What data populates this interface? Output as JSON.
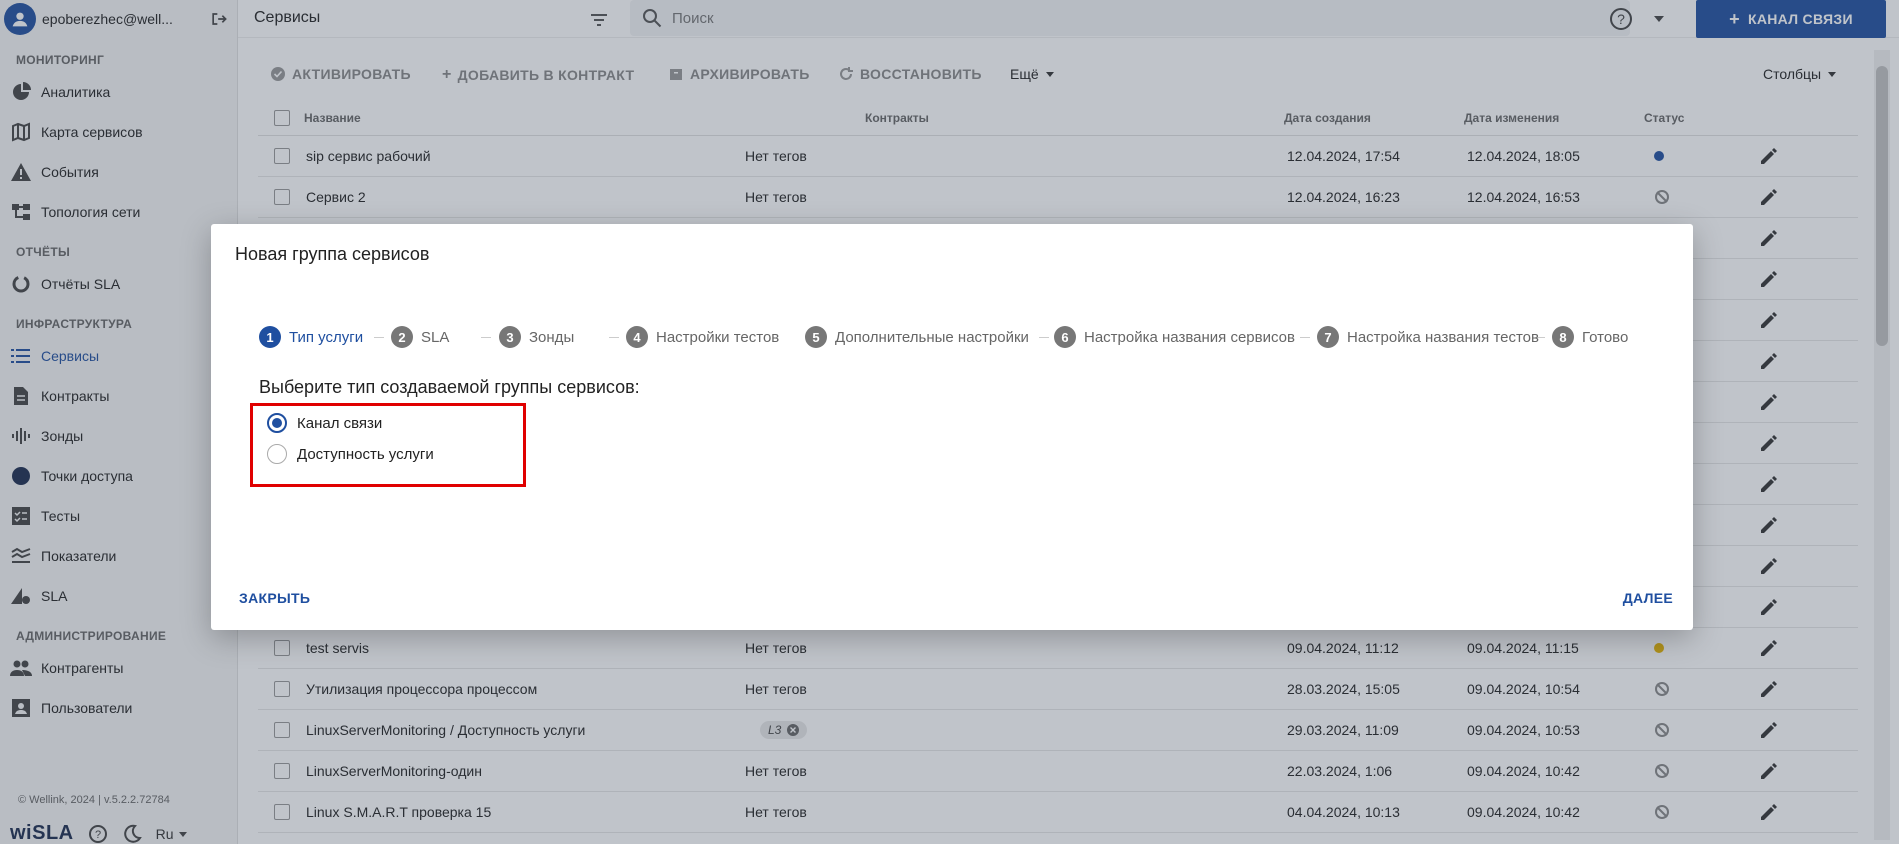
{
  "sidebar": {
    "user": "epoberezhec@well...",
    "sections": [
      {
        "title": "МОНИТОРИНГ",
        "items": [
          {
            "label": "Аналитика",
            "icon": "pie-chart-icon"
          },
          {
            "label": "Карта сервисов",
            "icon": "map-icon"
          },
          {
            "label": "События",
            "icon": "warning-icon"
          },
          {
            "label": "Топология сети",
            "icon": "topology-icon"
          }
        ]
      },
      {
        "title": "ОТЧЁТЫ",
        "items": [
          {
            "label": "Отчёты SLA",
            "icon": "donut-icon"
          }
        ]
      },
      {
        "title": "ИНФРАСТРУКТУРА",
        "items": [
          {
            "label": "Сервисы",
            "icon": "list-icon"
          },
          {
            "label": "Контракты",
            "icon": "document-icon"
          },
          {
            "label": "Зонды",
            "icon": "probe-icon"
          },
          {
            "label": "Точки доступа",
            "icon": "circle-icon"
          },
          {
            "label": "Тесты",
            "icon": "checklist-icon"
          },
          {
            "label": "Показатели",
            "icon": "metrics-icon"
          },
          {
            "label": "SLA",
            "icon": "sla-icon"
          }
        ]
      },
      {
        "title": "АДМИНИСТРИРОВАНИЕ",
        "items": [
          {
            "label": "Контрагенты",
            "icon": "people-icon"
          },
          {
            "label": "Пользователи",
            "icon": "user-card-icon"
          }
        ]
      }
    ],
    "copyright": "© Wellink, 2024 | v.5.2.2.72784",
    "logo": "wiSLA",
    "lang": "Ru"
  },
  "topbar": {
    "title": "Сервисы",
    "search_placeholder": "Поиск",
    "primary_button": "КАНАЛ СВЯЗИ"
  },
  "toolbar": {
    "activate": "АКТИВИРОВАТЬ",
    "add_contract": "ДОБАВИТЬ В КОНТРАКТ",
    "archive": "АРХИВИРОВАТЬ",
    "restore": "ВОССТАНОВИТЬ",
    "more": "Ещё",
    "columns": "Столбцы"
  },
  "table": {
    "headers": {
      "name": "Название",
      "contracts": "Контракты",
      "created": "Дата создания",
      "modified": "Дата изменения",
      "status": "Статус"
    },
    "rows": [
      {
        "name": "sip сервис рабочий",
        "tags": "Нет тегов",
        "created": "12.04.2024, 17:54",
        "modified": "12.04.2024, 18:05",
        "status": "active"
      },
      {
        "name": "Сервис 2",
        "tags": "Нет тегов",
        "created": "12.04.2024, 16:23",
        "modified": "12.04.2024, 16:53",
        "status": "disabled"
      },
      {
        "name": "",
        "tags": "",
        "created": "",
        "modified": "",
        "status": "none"
      },
      {
        "name": "",
        "tags": "",
        "created": "",
        "modified": "",
        "status": "none"
      },
      {
        "name": "",
        "tags": "",
        "created": "",
        "modified": "",
        "status": "none"
      },
      {
        "name": "",
        "tags": "",
        "created": "",
        "modified": "",
        "status": "none"
      },
      {
        "name": "",
        "tags": "",
        "created": "",
        "modified": "",
        "status": "none"
      },
      {
        "name": "",
        "tags": "",
        "created": "",
        "modified": "",
        "status": "none"
      },
      {
        "name": "",
        "tags": "",
        "created": "",
        "modified": "",
        "status": "none"
      },
      {
        "name": "",
        "tags": "",
        "created": "",
        "modified": "",
        "status": "none"
      },
      {
        "name": "",
        "tags": "",
        "created": "",
        "modified": "",
        "status": "none"
      },
      {
        "name": "",
        "tags": "",
        "created": "",
        "modified": "",
        "status": "none"
      },
      {
        "name": "test servis",
        "tags": "Нет тегов",
        "created": "09.04.2024, 11:12",
        "modified": "09.04.2024, 11:15",
        "status": "warning"
      },
      {
        "name": "Утилизация процессора процессом",
        "tags": "Нет тегов",
        "created": "28.03.2024, 15:05",
        "modified": "09.04.2024, 10:54",
        "status": "disabled"
      },
      {
        "name": "LinuxServerMonitoring / Доступность услуги",
        "tag_chip": "L3",
        "created": "29.03.2024, 11:09",
        "modified": "09.04.2024, 10:53",
        "status": "disabled"
      },
      {
        "name": "LinuxServerMonitoring-один",
        "tags": "Нет тегов",
        "created": "22.03.2024, 1:06",
        "modified": "09.04.2024, 10:42",
        "status": "disabled"
      },
      {
        "name": "Linux S.M.A.R.T проверка 15",
        "tags": "Нет тегов",
        "created": "04.04.2024, 10:13",
        "modified": "09.04.2024, 10:42",
        "status": "disabled"
      }
    ]
  },
  "modal": {
    "title": "Новая группа сервисов",
    "steps": [
      {
        "num": "1",
        "label": "Тип услуги"
      },
      {
        "num": "2",
        "label": "SLA"
      },
      {
        "num": "3",
        "label": "Зонды"
      },
      {
        "num": "4",
        "label": "Настройки тестов"
      },
      {
        "num": "5",
        "label": "Дополнительные настройки"
      },
      {
        "num": "6",
        "label": "Настройка названия сервисов"
      },
      {
        "num": "7",
        "label": "Настройка названия тестов"
      },
      {
        "num": "8",
        "label": "Готово"
      }
    ],
    "question": "Выберите тип создаваемой группы сервисов:",
    "options": [
      "Канал связи",
      "Доступность услуги"
    ],
    "selected_option": "Канал связи",
    "close_button": "ЗАКРЫТЬ",
    "next_button": "ДАЛЕЕ"
  },
  "colors": {
    "accent": "#1f4fa0",
    "highlight": "#e00000",
    "status_active": "#1f4fa0",
    "status_warning": "#e6b400",
    "status_disabled": "#888888"
  }
}
